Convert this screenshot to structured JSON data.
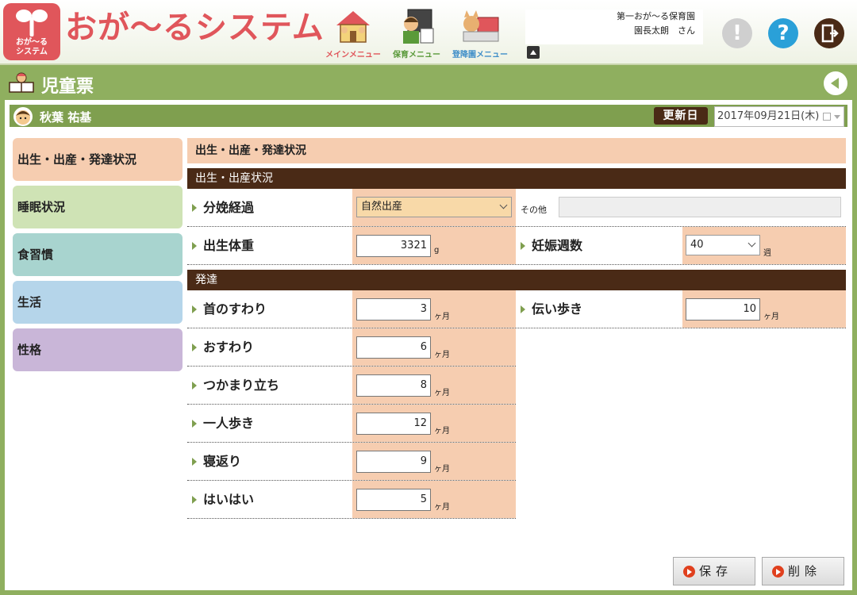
{
  "header": {
    "logo_text_line1": "おが～る",
    "logo_text_line2": "システム",
    "app_title": "おが～るシステム",
    "nav": [
      {
        "label": "メインメニュー",
        "color": "#e0565b"
      },
      {
        "label": "保育メニュー",
        "color": "#5a9a3a"
      },
      {
        "label": "登降園メニュー",
        "color": "#3f8ec8"
      }
    ],
    "facility": "第一おが～る保育園",
    "user": "園長太朗　さん",
    "alert_glyph": "!",
    "help_glyph": "?"
  },
  "page": {
    "title": "児童票"
  },
  "child": {
    "name": "秋葉 祐基",
    "update_label": "更新日",
    "update_date": "2017年09月21日(木)"
  },
  "tabs": [
    {
      "label": "出生・出産・発達状況",
      "color": "#f6cdb0"
    },
    {
      "label": "睡眠状況",
      "color": "#cfe3b5"
    },
    {
      "label": "食習慣",
      "color": "#a8d4cf"
    },
    {
      "label": "生活",
      "color": "#b5d5ea"
    },
    {
      "label": "性格",
      "color": "#c9b6d8"
    }
  ],
  "content": {
    "section_title": "出生・出産・発達状況",
    "birth_head": "出生・出産状況",
    "delivery": {
      "label": "分娩経過",
      "value": "自然出産",
      "other_label": "その他",
      "other_value": ""
    },
    "birth_weight": {
      "label": "出生体重",
      "value": "3321",
      "unit": "g"
    },
    "gestation": {
      "label": "妊娠週数",
      "value": "40",
      "unit": "週"
    },
    "dev_head": "発達",
    "head_control": {
      "label": "首のすわり",
      "value": "3",
      "unit": "ヶ月"
    },
    "cruising": {
      "label": "伝い歩き",
      "value": "10",
      "unit": "ヶ月"
    },
    "sitting": {
      "label": "おすわり",
      "value": "6",
      "unit": "ヶ月"
    },
    "pull_stand": {
      "label": "つかまり立ち",
      "value": "8",
      "unit": "ヶ月"
    },
    "walking": {
      "label": "一人歩き",
      "value": "12",
      "unit": "ヶ月"
    },
    "rolling": {
      "label": "寝返り",
      "value": "9",
      "unit": "ヶ月"
    },
    "crawling": {
      "label": "はいはい",
      "value": "5",
      "unit": "ヶ月"
    }
  },
  "footer": {
    "save_label": "保存",
    "delete_label": "削除"
  },
  "colors": {
    "brand": "#e0565b",
    "frame": "#8faf5f",
    "dark_brown": "#4a2a16",
    "peach": "#f6cdb0"
  }
}
